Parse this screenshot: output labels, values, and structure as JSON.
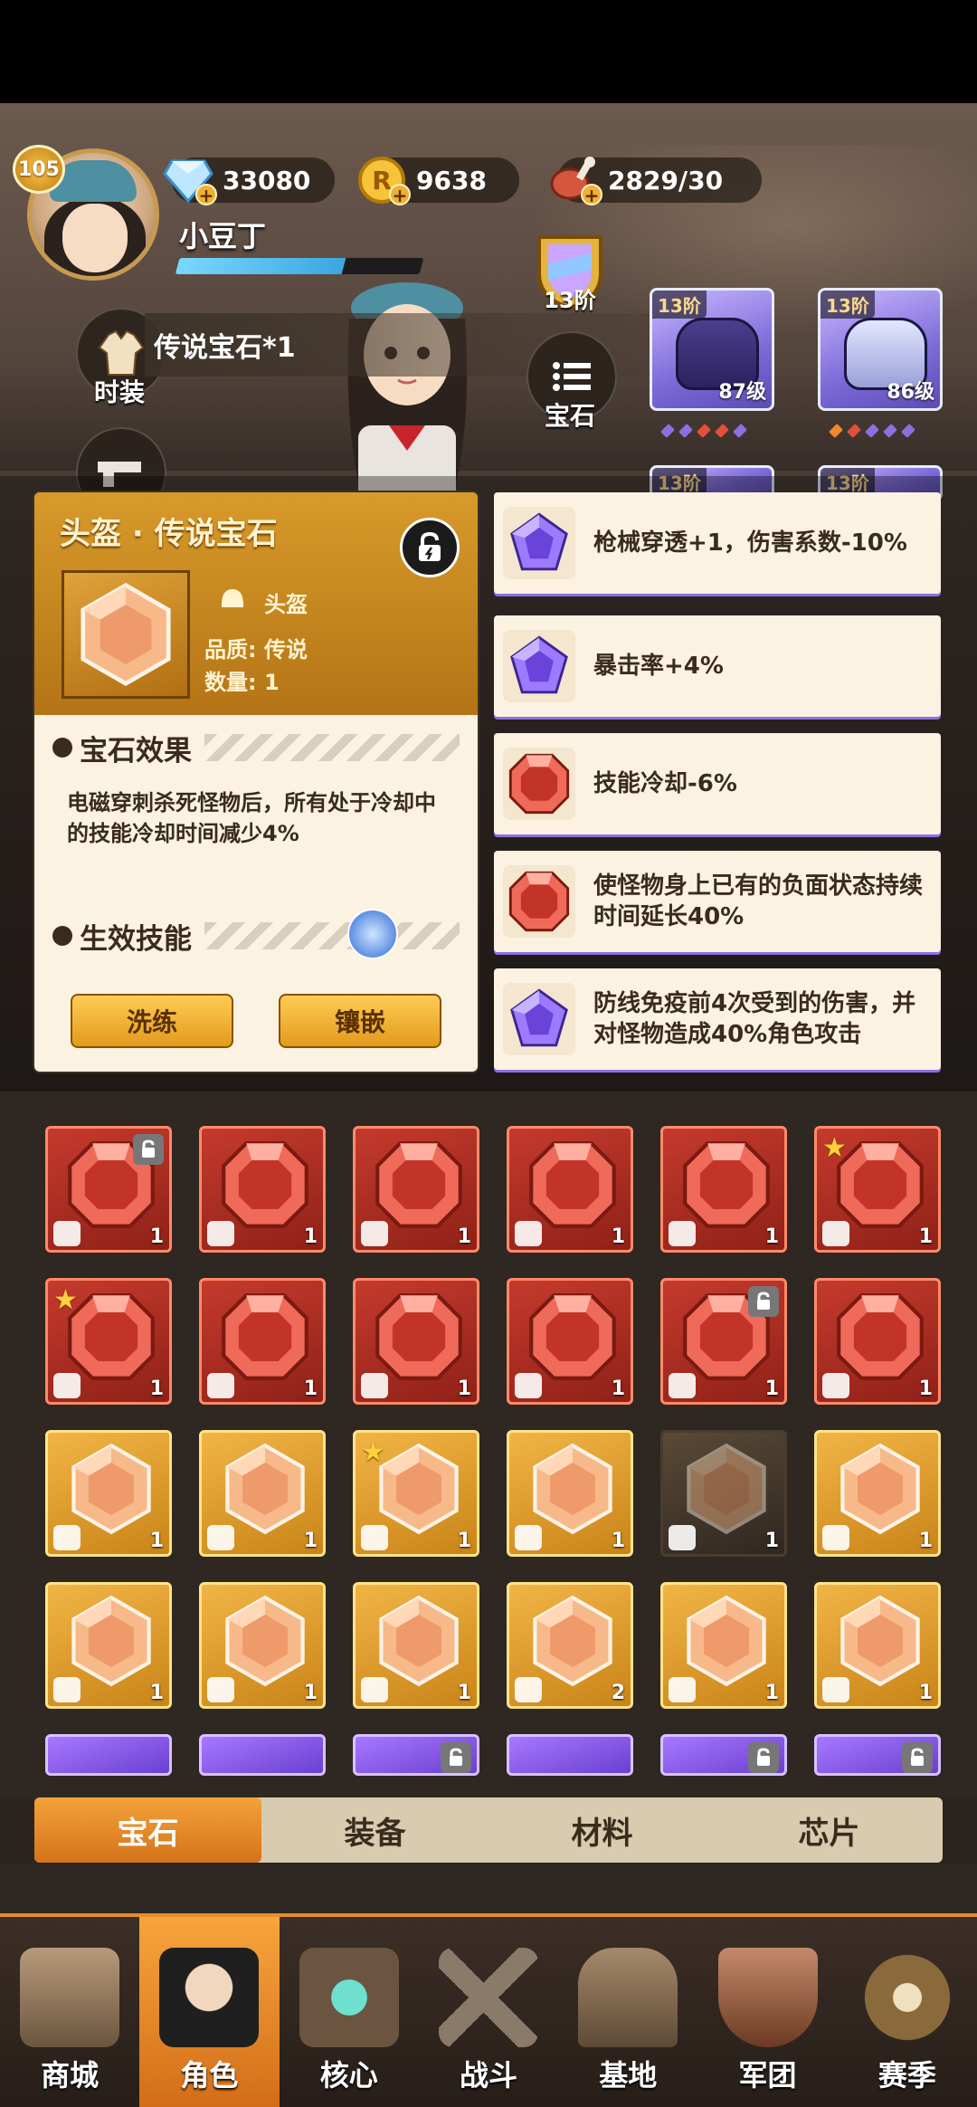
{
  "player": {
    "level": "105",
    "name": "小豆丁",
    "xp_fraction": 0.68
  },
  "resources": [
    {
      "name": "diamond",
      "value": "33080"
    },
    {
      "name": "gold-coin",
      "value": "9638"
    },
    {
      "name": "stamina-meat",
      "value": "2829/30"
    }
  ],
  "tier": {
    "label": "13阶"
  },
  "side_buttons": {
    "costume": "时装",
    "gem": "宝石"
  },
  "reward_strip": "传说宝石*1",
  "gear_cards": [
    {
      "tier": "13阶",
      "level": "87级",
      "dots": [
        "#8e6fe0",
        "#8e6fe0",
        "#e0503a",
        "#e0503a",
        "#8e6fe0"
      ]
    },
    {
      "tier": "13阶",
      "level": "86级",
      "dots": [
        "#f08a2a",
        "#e0503a",
        "#8e6fe0",
        "#8e6fe0",
        "#8e6fe0"
      ]
    }
  ],
  "gear_cards_row2": [
    {
      "tier": "13阶"
    },
    {
      "tier": "13阶"
    }
  ],
  "gem_detail": {
    "title": "头盔 · 传说宝石",
    "slot": "头盔",
    "quality_label": "品质: 传说",
    "quantity_label": "数量: 1",
    "effect_title": "宝石效果",
    "effect_desc": "电磁穿刺杀死怪物后，所有处于冷却中的技能冷却时间减少4%",
    "skill_title": "生效技能",
    "refine_btn": "洗练",
    "inlay_btn": "镶嵌"
  },
  "effects": [
    {
      "text": "枪械穿透+1，伤害系数-10%",
      "gem": "purple"
    },
    {
      "text": "暴击率+4%",
      "gem": "purple"
    },
    {
      "text": "技能冷却-6%",
      "gem": "red"
    },
    {
      "text": "使怪物身上已有的负面状态持续时间延长40%",
      "gem": "red"
    },
    {
      "text": "防线免疫前4次受到的伤害，并对怪物造成40%角色攻击",
      "gem": "purple"
    }
  ],
  "inventory": [
    [
      {
        "c": "red",
        "n": "1",
        "t": "helmet",
        "b": "lock"
      },
      {
        "c": "red",
        "n": "1",
        "t": "helmet"
      },
      {
        "c": "red",
        "n": "1",
        "t": "armor"
      },
      {
        "c": "red",
        "n": "1",
        "t": "armor"
      },
      {
        "c": "red",
        "n": "1",
        "t": "boots"
      },
      {
        "c": "red",
        "n": "1",
        "t": "gun",
        "s": true
      }
    ],
    [
      {
        "c": "red",
        "n": "1",
        "t": "gun",
        "s": true
      },
      {
        "c": "red",
        "n": "1",
        "t": "gun"
      },
      {
        "c": "red",
        "n": "1",
        "t": "pants"
      },
      {
        "c": "red",
        "n": "1",
        "t": "glove"
      },
      {
        "c": "red",
        "n": "1",
        "t": "glove",
        "b": "lock"
      },
      {
        "c": "red",
        "n": "1",
        "t": "glove"
      }
    ],
    [
      {
        "c": "gold",
        "n": "1",
        "t": "helmet"
      },
      {
        "c": "gold",
        "n": "1",
        "t": "helmet"
      },
      {
        "c": "gold",
        "n": "1",
        "t": "helmet",
        "s": true
      },
      {
        "c": "gold",
        "n": "1",
        "t": "helmet"
      },
      {
        "c": "dark",
        "n": "1",
        "t": "armor"
      },
      {
        "c": "gold",
        "n": "1",
        "t": "gun"
      }
    ],
    [
      {
        "c": "gold",
        "n": "1",
        "t": "gun"
      },
      {
        "c": "gold",
        "n": "1",
        "t": "pants"
      },
      {
        "c": "gold",
        "n": "1",
        "t": "pants"
      },
      {
        "c": "gold",
        "n": "2",
        "t": "pants"
      },
      {
        "c": "gold",
        "n": "1",
        "t": "glove"
      },
      {
        "c": "gold",
        "n": "1",
        "t": "glove"
      }
    ],
    [
      {
        "c": "purple"
      },
      {
        "c": "purple"
      },
      {
        "c": "purple",
        "b": "lock"
      },
      {
        "c": "purple"
      },
      {
        "c": "purple",
        "b": "lock"
      },
      {
        "c": "purple",
        "b": "lock"
      }
    ]
  ],
  "tabs": [
    "宝石",
    "装备",
    "材料",
    "芯片"
  ],
  "nav": [
    "商城",
    "角色",
    "核心",
    "战斗",
    "基地",
    "军团",
    "赛季"
  ],
  "colors": {
    "accent": "#e48f2a",
    "legend": "#b47416",
    "epic": "#8e6fe0",
    "red_gem": "#c53a2d"
  }
}
